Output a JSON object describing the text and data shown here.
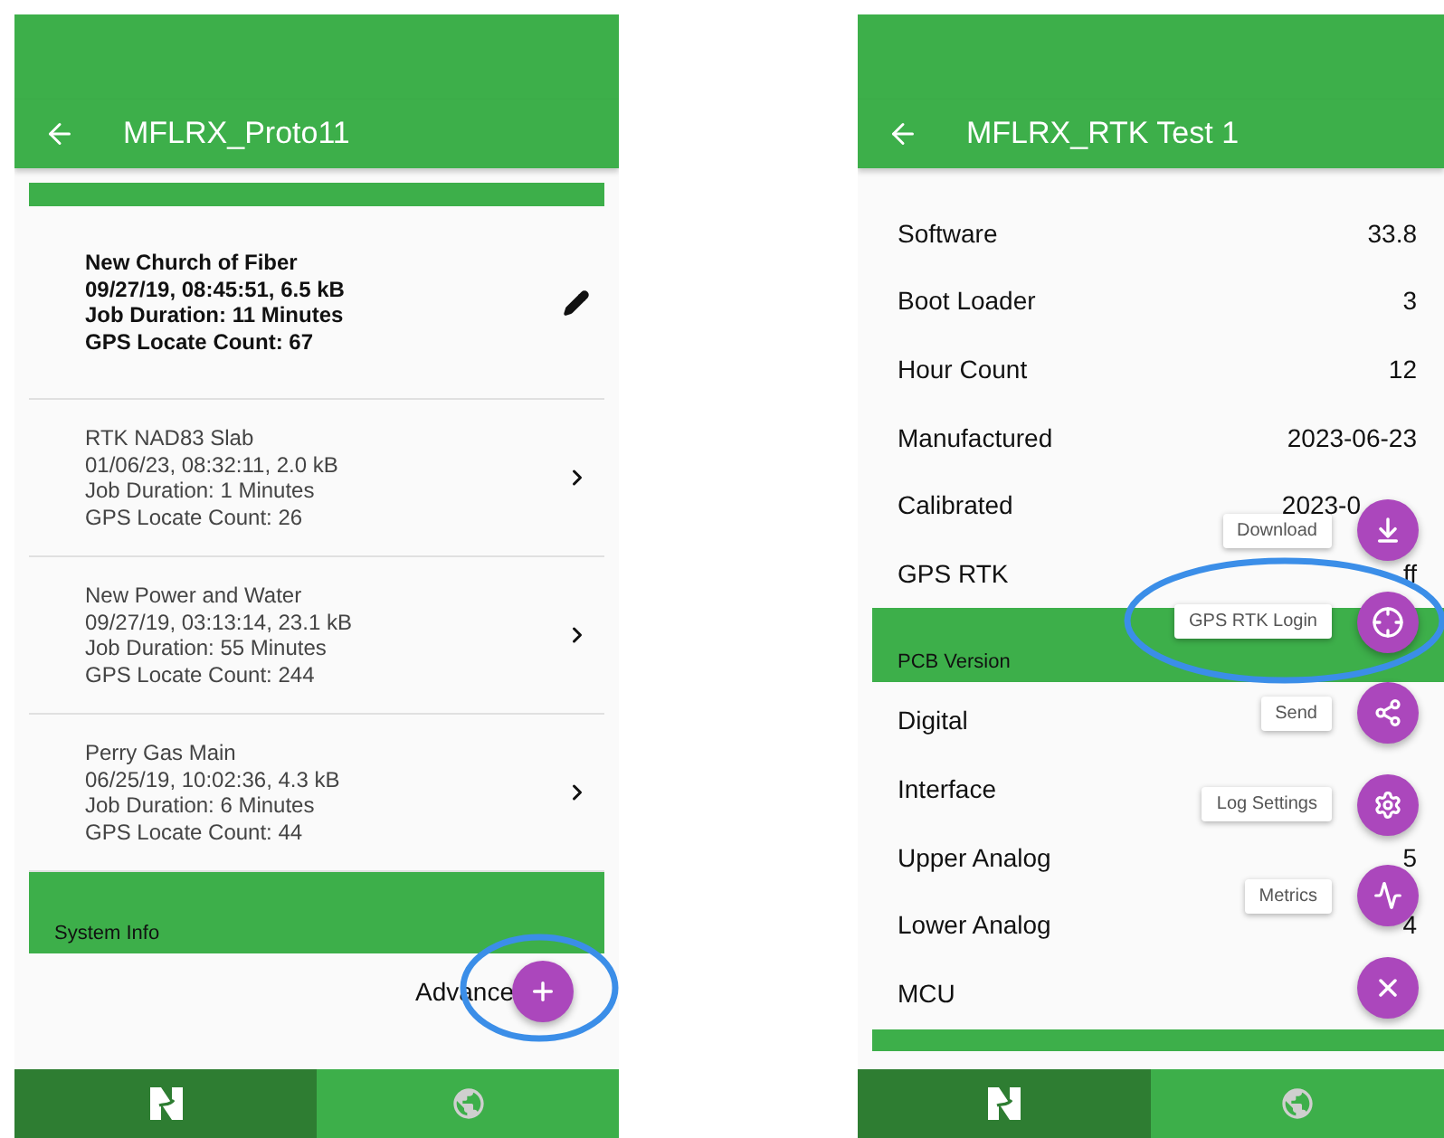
{
  "left_screen": {
    "app_bar": {
      "title": "MFLRX_Proto11"
    },
    "jobs": [
      {
        "name": "New Church of Fiber",
        "details": "09/27/19, 08:45:51, 6.5 kB",
        "duration": "Job Duration: 11 Minutes",
        "locate_count": "GPS Locate Count: 67",
        "selected": true
      },
      {
        "name": "RTK NAD83 Slab",
        "details": "01/06/23, 08:32:11, 2.0 kB",
        "duration": "Job Duration: 1 Minutes",
        "locate_count": "GPS Locate Count: 26",
        "selected": false
      },
      {
        "name": "New Power and Water",
        "details": "09/27/19, 03:13:14, 23.1 kB",
        "duration": "Job Duration: 55 Minutes",
        "locate_count": "GPS Locate Count: 244",
        "selected": false
      },
      {
        "name": "Perry Gas Main",
        "details": "06/25/19, 10:02:36, 4.3 kB",
        "duration": "Job Duration: 6 Minutes",
        "locate_count": "GPS Locate Count: 44",
        "selected": false
      }
    ],
    "section_header": "System Info",
    "advanced_label": "Advance",
    "bottom_nav": [
      {
        "kind": "logo",
        "selected": true
      },
      {
        "kind": "globe",
        "selected": false
      }
    ]
  },
  "right_screen": {
    "app_bar": {
      "title": "MFLRX_RTK Test 1"
    },
    "info_rows": [
      {
        "label": "Software",
        "value": "33.8"
      },
      {
        "label": "Boot Loader",
        "value": "3"
      },
      {
        "label": "Hour Count",
        "value": "12"
      },
      {
        "label": "Manufactured",
        "value": "2023-06-23"
      },
      {
        "label": "Calibrated",
        "value": "2023-0",
        "covered": true
      },
      {
        "label": "GPS RTK",
        "value": "ff"
      }
    ],
    "section_header": "PCB Version",
    "pcb_rows": [
      {
        "label": "Digital"
      },
      {
        "label": "Interface"
      },
      {
        "label": "Upper Analog",
        "value": "5"
      },
      {
        "label": "Lower Analog",
        "value": "4"
      },
      {
        "label": "MCU"
      }
    ],
    "actions": [
      {
        "kind": "download",
        "label": "Download"
      },
      {
        "kind": "locate",
        "label": "GPS RTK Login"
      },
      {
        "kind": "share",
        "label": "Send"
      },
      {
        "kind": "settings",
        "label": "Log Settings"
      },
      {
        "kind": "metrics",
        "label": "Metrics"
      },
      {
        "kind": "close"
      }
    ],
    "bottom_nav": [
      {
        "kind": "logo",
        "selected": true
      },
      {
        "kind": "globe",
        "selected": false
      }
    ]
  }
}
